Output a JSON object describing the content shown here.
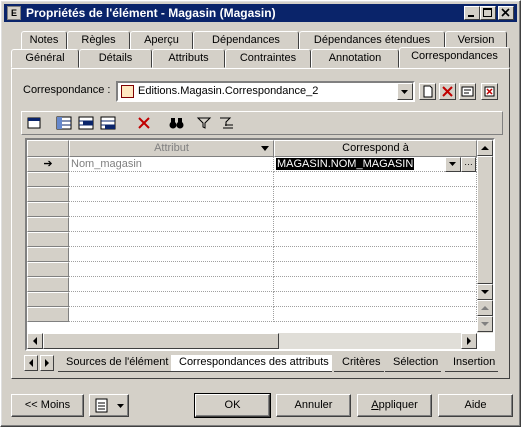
{
  "window": {
    "title": "Propriétés de l'élément - Magasin (Magasin)",
    "app_icon_letter": "E"
  },
  "tabs_row1": [
    {
      "label": "Notes"
    },
    {
      "label": "Règles"
    },
    {
      "label": "Aperçu"
    },
    {
      "label": "Dépendances"
    },
    {
      "label": "Dépendances étendues"
    },
    {
      "label": "Version"
    }
  ],
  "tabs_row2": [
    {
      "label": "Général"
    },
    {
      "label": "Détails"
    },
    {
      "label": "Attributs"
    },
    {
      "label": "Contraintes"
    },
    {
      "label": "Annotation"
    },
    {
      "label": "Correspondances",
      "active": true
    }
  ],
  "correspondance": {
    "label": "Correspondance :",
    "value": "Editions.Magasin.Correspondance_2"
  },
  "grid": {
    "columns": [
      "Attribut",
      "Correspond à"
    ],
    "rows": [
      {
        "attribut": "Nom_magasin",
        "correspond": "MAGASIN.NOM_MAGASIN",
        "current": true
      }
    ],
    "row_marker": "➔"
  },
  "bottom_tabs": [
    {
      "label": "Sources de l'élément"
    },
    {
      "label": "Correspondances des attributs",
      "active": true
    },
    {
      "label": "Critères"
    },
    {
      "label": "Sélection"
    },
    {
      "label": "Insertion"
    }
  ],
  "buttons": {
    "less": "<< Moins",
    "ok": "OK",
    "cancel": "Annuler",
    "apply": "Appliquer",
    "apply_mnemonic": "A",
    "apply_rest": "ppliquer",
    "help": "Aide"
  },
  "colors": {
    "titlebar": "#0a246a",
    "selection": "#000000"
  }
}
